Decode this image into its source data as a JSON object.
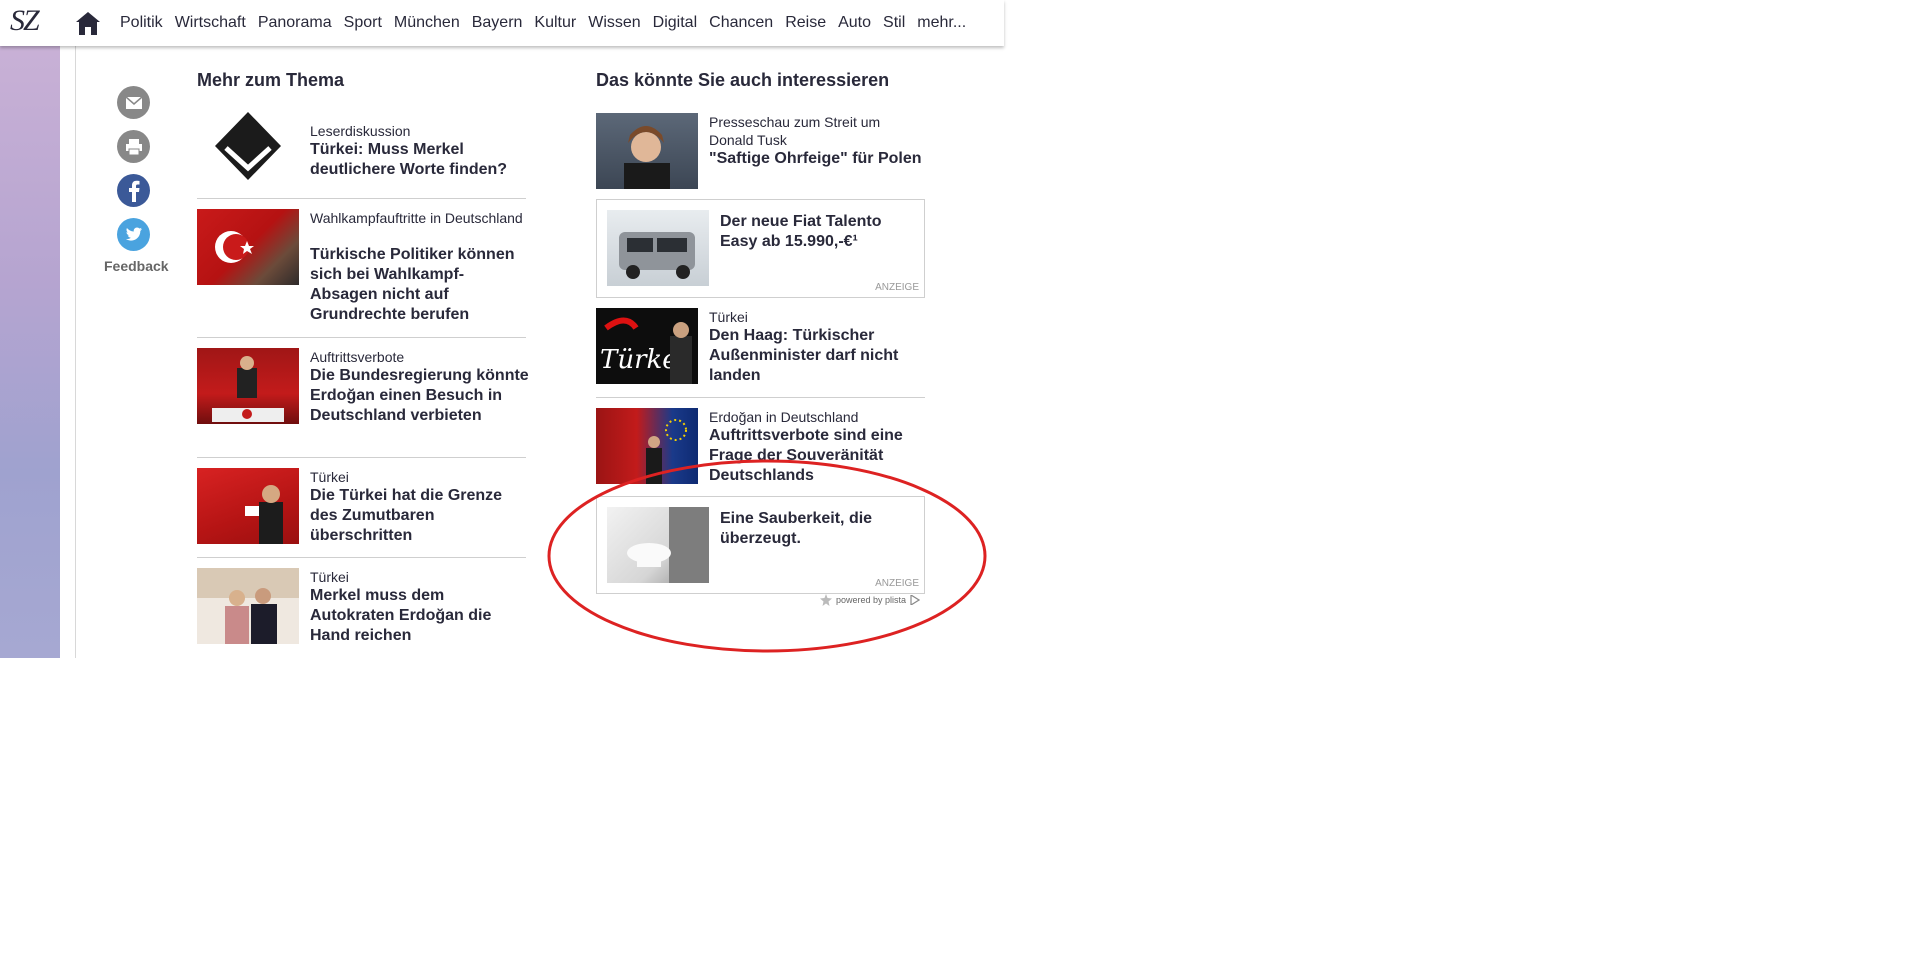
{
  "header": {
    "logo": "SZ",
    "nav": [
      "Politik",
      "Wirtschaft",
      "Panorama",
      "Sport",
      "München",
      "Bayern",
      "Kultur",
      "Wissen",
      "Digital",
      "Chancen",
      "Reise",
      "Auto",
      "Stil",
      "mehr..."
    ]
  },
  "share": {
    "feedback": "Feedback",
    "icons": [
      "mail-icon",
      "print-icon",
      "facebook-icon",
      "twitter-icon"
    ]
  },
  "left_column": {
    "title": "Mehr zum Thema",
    "items": [
      {
        "kicker": "Leserdiskussion",
        "headline": "Türkei: Muss Merkel deutlichere Worte finden?"
      },
      {
        "kicker": "Wahlkampfauftritte in Deutschland",
        "headline": "Türkische Politiker können sich bei Wahlkampf-Absagen nicht auf Grundrechte berufen"
      },
      {
        "kicker": "Auftrittsverbote",
        "headline": "Die Bundesregierung könnte Erdoğan einen Besuch in Deutschland verbieten"
      },
      {
        "kicker": "Türkei",
        "headline": "Die Türkei hat die Grenze des Zumutbaren überschritten"
      },
      {
        "kicker": "Türkei",
        "headline": "Merkel muss dem Autokraten Erdoğan die Hand reichen"
      }
    ]
  },
  "right_column": {
    "title": "Das könnte Sie auch interessieren",
    "item1": {
      "kicker": "Presseschau zum Streit um Donald Tusk",
      "headline": "\"Saftige Ohrfeige\" für Polen"
    },
    "ad1": {
      "headline": "Der neue Fiat Talento Easy ab 15.990,-€¹",
      "label": "ANZEIGE"
    },
    "item2": {
      "kicker": "Türkei",
      "headline": "Den Haag: Türkischer Außenminister darf nicht landen"
    },
    "item3": {
      "kicker": "Erdoğan in Deutschland",
      "headline": "Auftrittsverbote sind eine Frage der Souveränität Deutschlands"
    },
    "ad2": {
      "headline": "Eine Sauberkeit, die überzeugt.",
      "label": "ANZEIGE"
    },
    "powered": "powered by plista"
  },
  "colors": {
    "text": "#29293a",
    "annotation": "#dd2222",
    "facebook": "#3b5998",
    "twitter": "#4aa3df"
  }
}
